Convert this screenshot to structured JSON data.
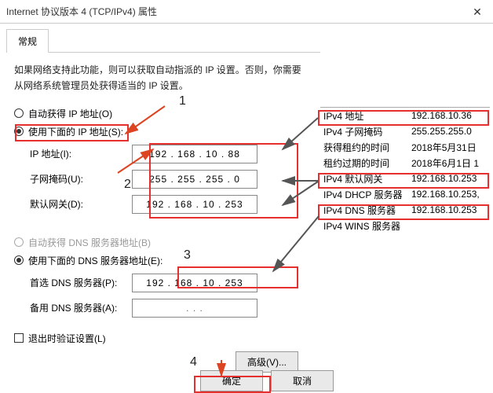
{
  "window": {
    "title": "Internet 协议版本 4 (TCP/IPv4) 属性",
    "tab": "常规",
    "description": "如果网络支持此功能，则可以获取自动指派的 IP 设置。否则，你需要从网络系统管理员处获得适当的 IP 设置。"
  },
  "ip_section": {
    "auto_label": "自动获得 IP 地址(O)",
    "manual_label": "使用下面的 IP 地址(S):",
    "ip_label": "IP 地址(I):",
    "ip_value": "192 . 168 . 10 . 88",
    "mask_label": "子网掩码(U):",
    "mask_value": "255 . 255 . 255 . 0",
    "gw_label": "默认网关(D):",
    "gw_value": "192 . 168 . 10 . 253"
  },
  "dns_section": {
    "auto_label": "自动获得 DNS 服务器地址(B)",
    "manual_label": "使用下面的 DNS 服务器地址(E):",
    "primary_label": "首选 DNS 服务器(P):",
    "primary_value": "192 . 168 . 10 . 253",
    "alt_label": "备用 DNS 服务器(A):",
    "alt_value": ".       .       ."
  },
  "footer": {
    "validate": "退出时验证设置(L)",
    "advanced": "高级(V)...",
    "ok": "确定",
    "cancel": "取消"
  },
  "info": {
    "rows": [
      {
        "label": "IPv4 地址",
        "value": "192.168.10.36"
      },
      {
        "label": "IPv4 子网掩码",
        "value": "255.255.255.0"
      },
      {
        "label": "获得租约的时间",
        "value": "2018年5月31日"
      },
      {
        "label": "租约过期的时间",
        "value": "2018年6月1日 1"
      },
      {
        "label": "IPv4 默认网关",
        "value": "192.168.10.253"
      },
      {
        "label": "IPv4 DHCP 服务器",
        "value": "192.168.10.253,"
      },
      {
        "label": "IPv4 DNS 服务器",
        "value": "192.168.10.253"
      },
      {
        "label": "IPv4 WINS 服务器",
        "value": ""
      }
    ]
  },
  "anno": {
    "n1": "1",
    "n2": "2",
    "n3": "3",
    "n4": "4"
  }
}
